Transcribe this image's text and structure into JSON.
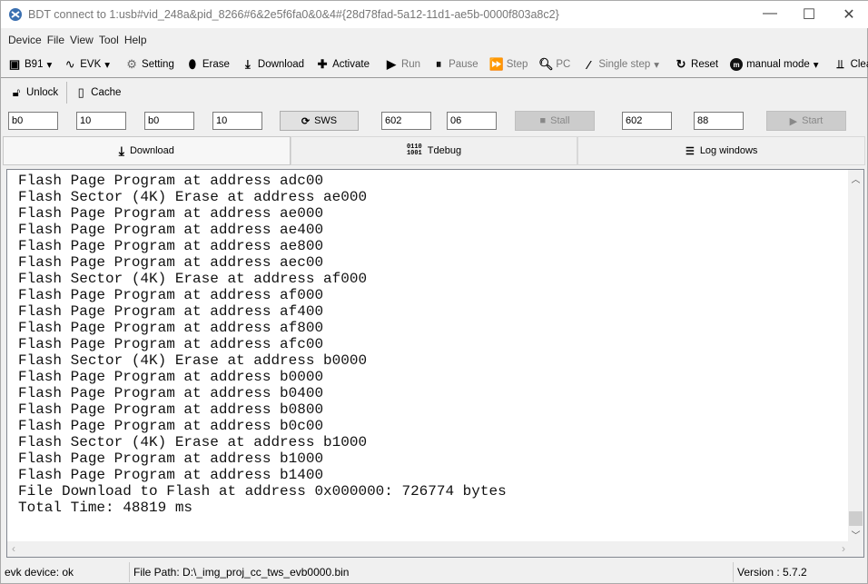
{
  "window": {
    "title": "BDT connect to 1:usb#vid_248a&pid_8266#6&2e5f6fa0&0&4#{28d78fad-5a12-11d1-ae5b-0000f803a8c2}",
    "minimize": "—",
    "maximize": "☐",
    "close": "✕"
  },
  "menu": [
    "Device",
    "File",
    "View",
    "Tool",
    "Help"
  ],
  "toolbar": {
    "chip": "B91",
    "board": "EVK",
    "setting": "Setting",
    "erase": "Erase",
    "download": "Download",
    "activate": "Activate",
    "run": "Run",
    "pause": "Pause",
    "step": "Step",
    "pc": "PC",
    "single_step": "Single step",
    "reset": "Reset",
    "mode": "manual mode",
    "clear": "Clear"
  },
  "toolbar2": {
    "unlock": "Unlock",
    "cache": "Cache"
  },
  "fields": {
    "f1": "b0",
    "f2": "10",
    "f3": "b0",
    "f4": "10",
    "sws": "SWS",
    "f5": "602",
    "f6": "06",
    "stall": "Stall",
    "f7": "602",
    "f8": "88",
    "start": "Start"
  },
  "tabs": [
    "Download",
    "Tdebug",
    "Log windows"
  ],
  "log": [
    "Flash Page Program at address adc00",
    "Flash Sector (4K) Erase at address ae000",
    "Flash Page Program at address ae000",
    "Flash Page Program at address ae400",
    "Flash Page Program at address ae800",
    "Flash Page Program at address aec00",
    "Flash Sector (4K) Erase at address af000",
    "Flash Page Program at address af000",
    "Flash Page Program at address af400",
    "Flash Page Program at address af800",
    "Flash Page Program at address afc00",
    "Flash Sector (4K) Erase at address b0000",
    "Flash Page Program at address b0000",
    "Flash Page Program at address b0400",
    "Flash Page Program at address b0800",
    "Flash Page Program at address b0c00",
    "Flash Sector (4K) Erase at address b1000",
    "Flash Page Program at address b1000",
    "Flash Page Program at address b1400",
    "File Download to Flash at address 0x000000: 726774 bytes",
    "Total Time: 48819 ms"
  ],
  "status": {
    "device": "evk device: ok",
    "path": "File Path:  D:\\_img_proj_cc_tws_evb0000.bin",
    "version": "Version : 5.7.2"
  }
}
